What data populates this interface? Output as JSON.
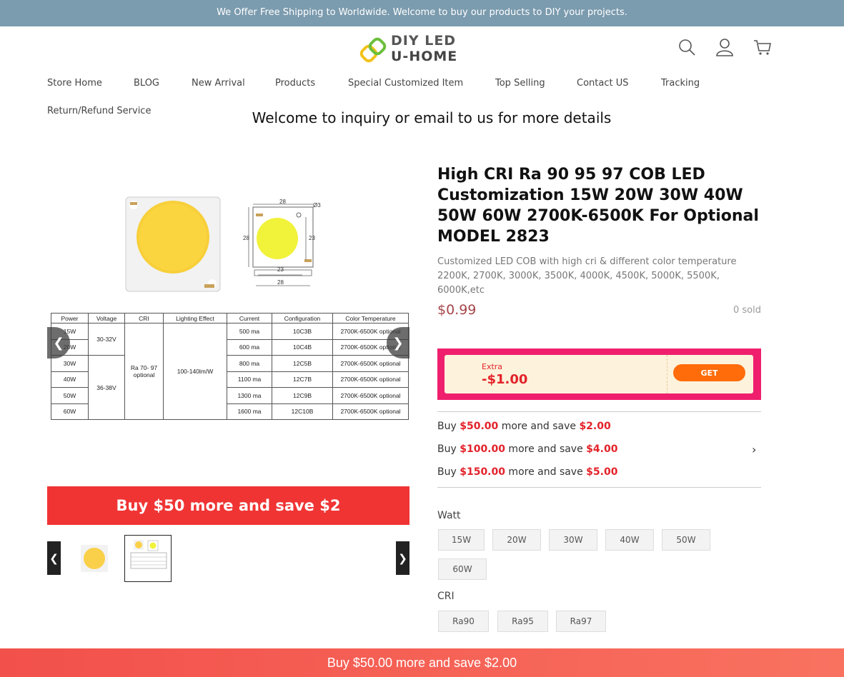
{
  "topbar": {
    "text": "We Offer Free Shipping to Worldwide. Welcome to buy our products to DIY your projects."
  },
  "logo": {
    "line1": "DIY LED",
    "line2": "U-HOME"
  },
  "header_icons": [
    "search-icon",
    "user-icon",
    "cart-icon"
  ],
  "nav": {
    "items": [
      "Store Home",
      "BLOG",
      "New Arrival",
      "Products",
      "Special Customized Item",
      "Top Selling",
      "Contact US",
      "Tracking",
      "Return/Refund Service"
    ]
  },
  "welcome": "Welcome to inquiry or email to us for more details",
  "gallery": {
    "dims": {
      "top": "28",
      "side_left": "28",
      "side_right": "23",
      "bottom1": "23",
      "bottom2": "28",
      "dia": "Ø3"
    },
    "table": {
      "headers": [
        "Power",
        "Voltage",
        "CRI",
        "Lighting Effect",
        "Current",
        "Configuration",
        "Color Temperature"
      ],
      "rows": [
        {
          "power": "15W",
          "current": "500 ma",
          "config": "10C3B",
          "temp": "2700K-6500K optional"
        },
        {
          "power": "20W",
          "current": "600 ma",
          "config": "10C4B",
          "temp": "2700K-6500K optional"
        },
        {
          "power": "30W",
          "current": "800 ma",
          "config": "12C5B",
          "temp": "2700K-6500K optional"
        },
        {
          "power": "40W",
          "current": "1100 ma",
          "config": "12C7B",
          "temp": "2700K-6500K optional"
        },
        {
          "power": "50W",
          "current": "1300 ma",
          "config": "12C9B",
          "temp": "2700K-6500K optional"
        },
        {
          "power": "60W",
          "current": "1600 ma",
          "config": "12C10B",
          "temp": "2700K-6500K optional"
        }
      ],
      "voltage_a": "30-32V",
      "voltage_b": "36-38V",
      "cri_line1": "Ra 70- 97",
      "cri_line2": "optional",
      "effect": "100-140lm/W"
    },
    "promo_button": "Buy $50 more and save $2"
  },
  "product": {
    "title": "High CRI Ra 90 95 97 COB LED Customization 15W 20W 30W 40W 50W 60W 2700K-6500K For Optional MODEL 2823",
    "subtitle": "Customized LED COB with high cri & different color temperature 2200K, 2700K, 3000K, 3500K, 4000K, 4500K, 5000K, 5500K, 6000K,etc",
    "price": "$0.99",
    "sold": "0 sold"
  },
  "coupon": {
    "extra": "Extra",
    "amount": "-$1.00",
    "get": "GET"
  },
  "discounts": [
    {
      "pre": "Buy ",
      "amount": "$50.00",
      "mid": " more and save ",
      "save": "$2.00"
    },
    {
      "pre": "Buy ",
      "amount": "$100.00",
      "mid": " more and save ",
      "save": "$4.00"
    },
    {
      "pre": "Buy ",
      "amount": "$150.00",
      "mid": " more and save ",
      "save": "$5.00"
    }
  ],
  "options": {
    "watt_label": "Watt",
    "watt": [
      "15W",
      "20W",
      "30W",
      "40W",
      "50W",
      "60W"
    ],
    "cri_label": "CRI",
    "cri": [
      "Ra90",
      "Ra95",
      "Ra97"
    ]
  },
  "bottom_bar": "Buy $50.00 more and save $2.00"
}
